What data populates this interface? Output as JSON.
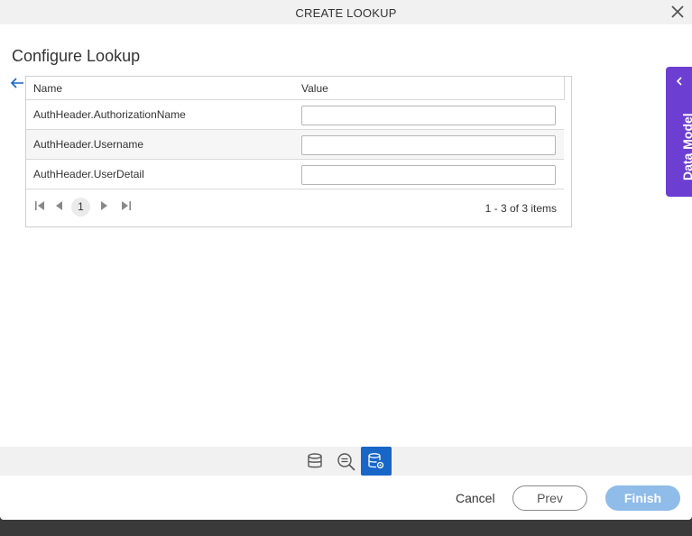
{
  "window": {
    "title": "CREATE LOOKUP"
  },
  "page": {
    "heading": "Configure Lookup"
  },
  "grid": {
    "columns": [
      "Name",
      "Value"
    ],
    "rows": [
      {
        "name": "AuthHeader.AuthorizationName",
        "value": ""
      },
      {
        "name": "AuthHeader.Username",
        "value": ""
      },
      {
        "name": "AuthHeader.UserDetail",
        "value": ""
      }
    ],
    "pager": {
      "current_page": "1",
      "info": "1 - 3 of 3 items"
    }
  },
  "side_panel": {
    "label": "Data Model"
  },
  "footer": {
    "cancel": "Cancel",
    "prev": "Prev",
    "finish": "Finish"
  },
  "colors": {
    "accent": "#1766c8",
    "side_tab": "#6c3ed1",
    "finish_disabled": "#8fbce8"
  },
  "icons": {
    "close": "close-icon",
    "back": "arrow-left-icon",
    "steps": [
      "database-icon",
      "search-filter-icon",
      "database-settings-icon"
    ]
  }
}
